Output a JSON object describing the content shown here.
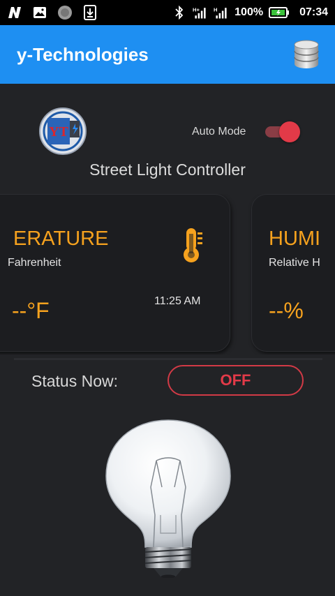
{
  "status_bar": {
    "icons_left": [
      "n-app-icon",
      "image-icon",
      "circle-app-icon",
      "download-icon"
    ],
    "icons_right": [
      "bluetooth-icon",
      "signal-h-plus-icon",
      "signal-h-icon",
      "battery-icon"
    ],
    "battery": "100%",
    "time": "07:34"
  },
  "app_bar": {
    "title": "y-Technologies",
    "action_icon": "database-icon",
    "color": "#1e8ff2"
  },
  "controls": {
    "logo_text": "YT",
    "auto_mode_label": "Auto Mode",
    "auto_mode_on": true,
    "subtitle": "Street Light Controller"
  },
  "cards": {
    "temperature": {
      "title": "ERATURE",
      "unit": "Fahrenheit",
      "value": "--°F",
      "time": "11:25 AM",
      "icon": "thermometer-icon"
    },
    "humidity": {
      "title": "HUMI",
      "unit": "Relative H",
      "value": "--%"
    }
  },
  "status": {
    "label": "Status Now:",
    "value": "OFF",
    "accent": "#e23a48"
  },
  "bulb": {
    "icon": "light-bulb-off"
  }
}
